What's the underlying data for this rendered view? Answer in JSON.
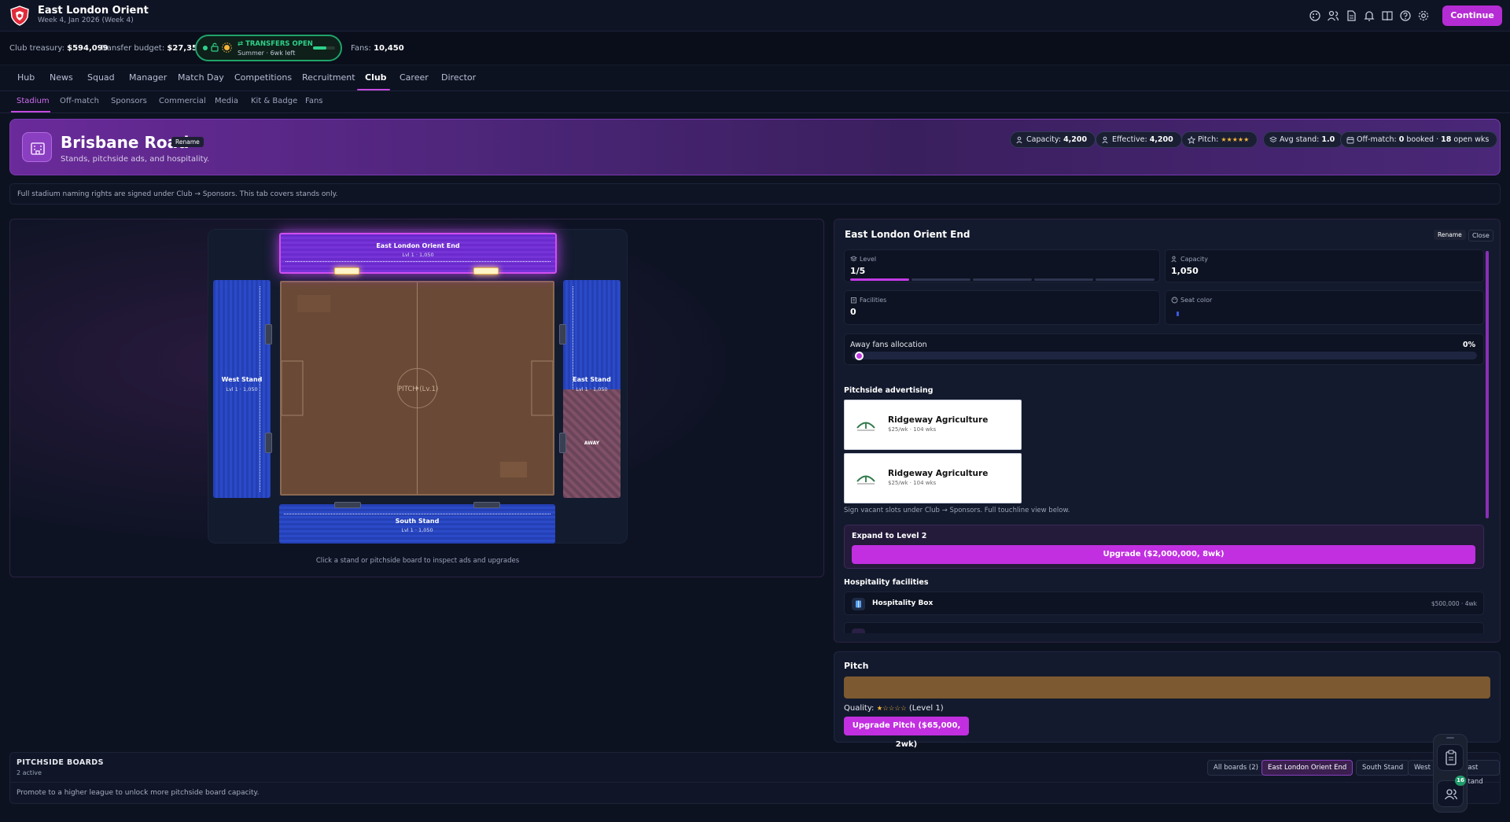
{
  "header": {
    "club_name": "East London Orient",
    "date": "Week 4, Jan 2026 (Week 4)",
    "continue_label": "Continue",
    "icons": [
      "palette-icon",
      "people-icon",
      "document-icon",
      "bell-icon",
      "book-icon",
      "help-icon",
      "settings-icon"
    ]
  },
  "status": {
    "treasury_label": "Club treasury:",
    "treasury_value": "$594,099",
    "budget_label": "Transfer budget:",
    "budget_value": "$27,357",
    "transfers_title": "TRANSFERS OPEN",
    "transfers_sub": "Summer · 6wk left",
    "transfers_progress": 0.6,
    "fans_label": "Fans:",
    "fans_value": "10,450"
  },
  "nav": {
    "items": [
      "Hub",
      "News",
      "Squad",
      "Manager",
      "Match Day",
      "Competitions",
      "Recruitment",
      "Club",
      "Career",
      "Director"
    ],
    "active": "Club"
  },
  "subnav": {
    "items": [
      "Stadium",
      "Off-match",
      "Sponsors",
      "Commercial",
      "Media",
      "Kit & Badge",
      "Fans"
    ],
    "active": "Stadium"
  },
  "hero": {
    "title": "Brisbane Road",
    "rename_label": "Rename",
    "subtitle": "Stands, pitchside ads, and hospitality.",
    "chips": {
      "capacity_label": "Capacity:",
      "capacity_value": "4,200",
      "effective_label": "Effective:",
      "effective_value": "4,200",
      "pitch_label": "Pitch:",
      "pitch_stars": "★★★★★",
      "avgstand_label": "Avg stand:",
      "avgstand_value": "1.0",
      "offmatch_label": "Off-match:",
      "offmatch_booked": "0",
      "offmatch_booked_label": "booked ·",
      "offmatch_open": "18",
      "offmatch_open_label": "open wks"
    }
  },
  "info_text": "Full stadium naming rights are signed under Club → Sponsors. This tab covers stands only.",
  "map": {
    "stands": {
      "top": {
        "name": "East London Orient End",
        "level": "Lvl 1 · 1,050"
      },
      "left": {
        "name": "West Stand",
        "level": "Lvl 1 · 1,050"
      },
      "right": {
        "name": "East Stand",
        "level": "Lvl 1 · 1,050"
      },
      "bottom": {
        "name": "South Stand",
        "level": "Lvl 1 · 1,050"
      }
    },
    "away_label": "AWAY",
    "pitch_label": "PITCH (Lv.1)",
    "hint": "Click a stand or pitchside board to inspect ads and upgrades"
  },
  "detail": {
    "title": "East London Orient End",
    "rename_label": "Rename",
    "close_label": "Close",
    "level_label": "Level",
    "level_value": "1/5",
    "level_current": 1,
    "level_max": 5,
    "capacity_label": "Capacity",
    "capacity_value": "1,050",
    "facilities_label": "Facilities",
    "facilities_value": "0",
    "seat_color_label": "Seat color",
    "seat_color": "#3a5ae0",
    "away_label": "Away fans allocation",
    "away_value": "0%",
    "away_fraction": 0,
    "ads_heading": "Pitchside advertising",
    "ads": [
      {
        "name": "Ridgeway Agriculture",
        "terms": "$25/wk · 104 wks"
      },
      {
        "name": "Ridgeway Agriculture",
        "terms": "$25/wk · 104 wks"
      }
    ],
    "ads_note": "Sign vacant slots under Club → Sponsors. Full touchline view below.",
    "expand_title": "Expand to Level 2",
    "expand_button": "Upgrade ($2,000,000, 8wk)",
    "hosp_heading": "Hospitality facilities",
    "hospitality": [
      {
        "name": "Hospitality Box",
        "cost": "$500,000 · 4wk"
      }
    ]
  },
  "pitch_panel": {
    "title": "Pitch",
    "quality_label": "Quality:",
    "quality_stars": "★☆☆☆☆",
    "quality_level": "(Level 1)",
    "upgrade_button": "Upgrade Pitch ($65,000, 2wk)",
    "pitch_color": "#7c5930"
  },
  "boards": {
    "title": "PITCHSIDE BOARDS",
    "count": "2 active",
    "note": "Promote to a higher league to unlock more pitchside board capacity.",
    "filters": [
      "All boards (2)",
      "East London Orient End",
      "South Stand",
      "West Stand",
      "East Stand"
    ],
    "active_filter": "East London Orient End"
  },
  "floating": {
    "people_badge": "16"
  }
}
